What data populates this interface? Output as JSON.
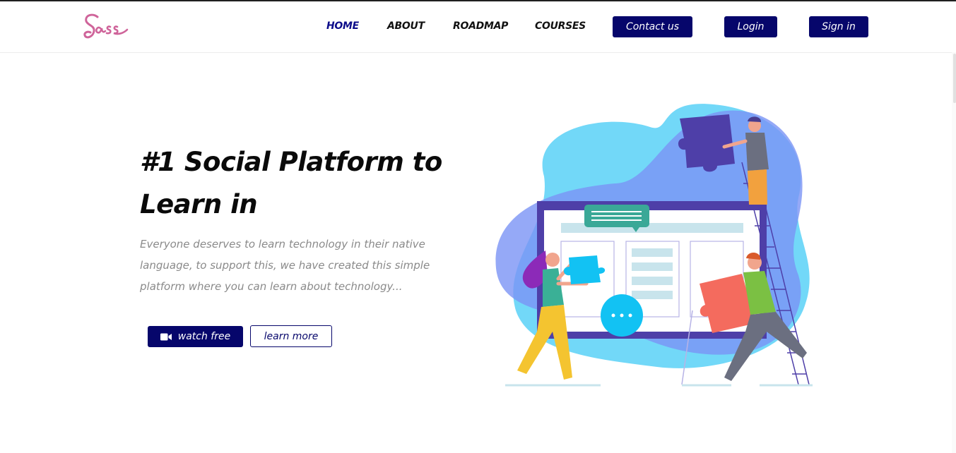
{
  "header": {
    "logo_text": "Sass",
    "nav": [
      {
        "label": "HOME",
        "active": true
      },
      {
        "label": "ABOUT"
      },
      {
        "label": "ROADMAP"
      },
      {
        "label": "COURSES"
      }
    ],
    "buttons": {
      "contact": "Contact us",
      "login": "Login",
      "signin": "Sign in"
    }
  },
  "hero": {
    "title_line1": "#1 Social Platform to",
    "title_line2": "Learn in",
    "description": "Everyone deserves to learn technology in their native language, to support this, we have created this simple platform where you can learn about technology...",
    "watch_button": "watch free",
    "watch_icon": "video-camera-icon",
    "learn_button": "learn more"
  },
  "colors": {
    "brand": "#06066b",
    "logo_pink": "#cf649a",
    "nav_active": "#0c0c8a",
    "body_text": "#8a8a8a"
  }
}
